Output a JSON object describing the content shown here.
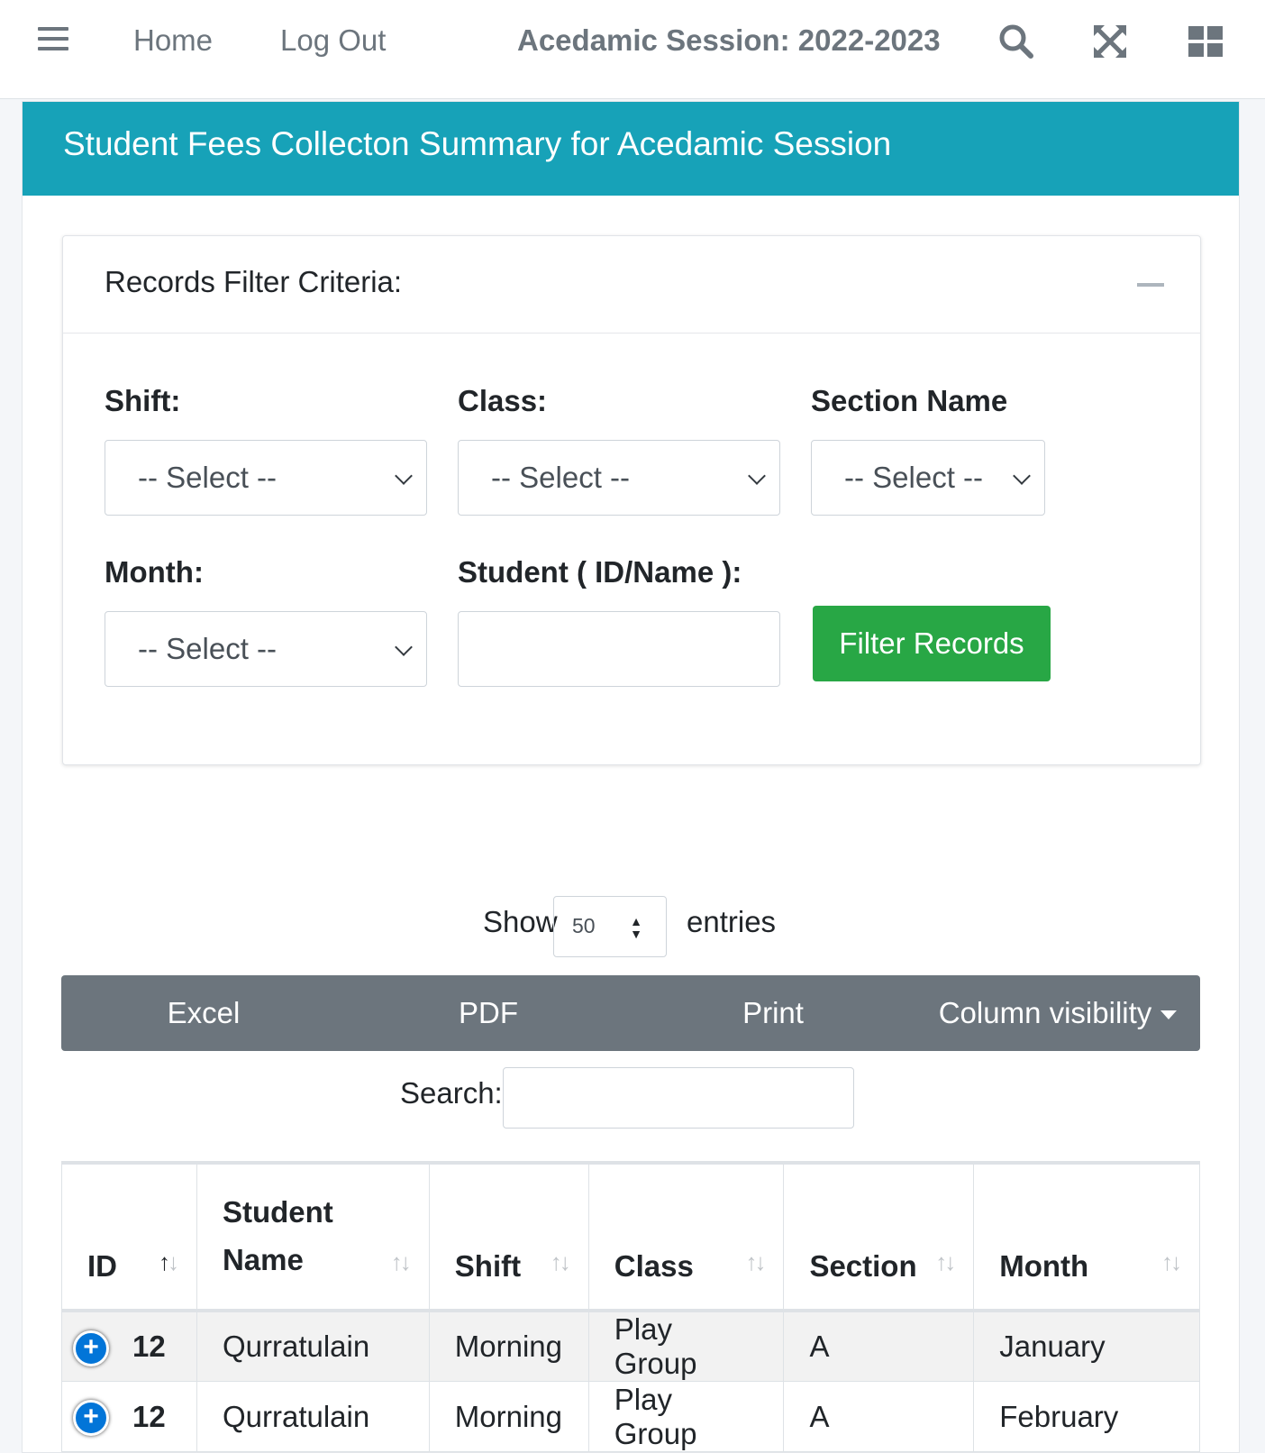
{
  "navbar": {
    "home": "Home",
    "logout": "Log Out",
    "session_title": "Acedamic Session: 2022-2023"
  },
  "card": {
    "title": "Student Fees Collecton Summary for Acedamic Session"
  },
  "filter": {
    "title": "Records Filter Criteria:",
    "shift_label": "Shift:",
    "shift_value": "-- Select --",
    "class_label": "Class:",
    "class_value": "-- Select --",
    "section_label": "Section Name",
    "section_value": "-- Select --",
    "month_label": "Month:",
    "month_value": "-- Select --",
    "student_label": "Student ( ID/Name ):",
    "student_value": "",
    "submit": "Filter Records"
  },
  "datatable": {
    "show": "Show",
    "entries": "entries",
    "page_length": "50",
    "buttons": [
      "Excel",
      "PDF",
      "Print",
      "Column visibility"
    ],
    "search_label": "Search:",
    "search_value": ""
  },
  "table": {
    "columns": [
      "ID",
      "Student Name",
      "Shift",
      "Class",
      "Section",
      "Month"
    ],
    "rows": [
      [
        "12",
        "Qurratulain",
        "Morning",
        "Play Group",
        "A",
        "January"
      ],
      [
        "12",
        "Qurratulain",
        "Morning",
        "Play Group",
        "A",
        "February"
      ]
    ]
  },
  "colors": {
    "header": "#17a2b8",
    "success": "#28a745",
    "secondary": "#6c757d",
    "expand": "#0275d8"
  },
  "icons": [
    "menu-icon",
    "search-icon",
    "fullscreen-icon",
    "grid-icon",
    "minus-icon",
    "chevron-down-icon",
    "plus-icon"
  ]
}
